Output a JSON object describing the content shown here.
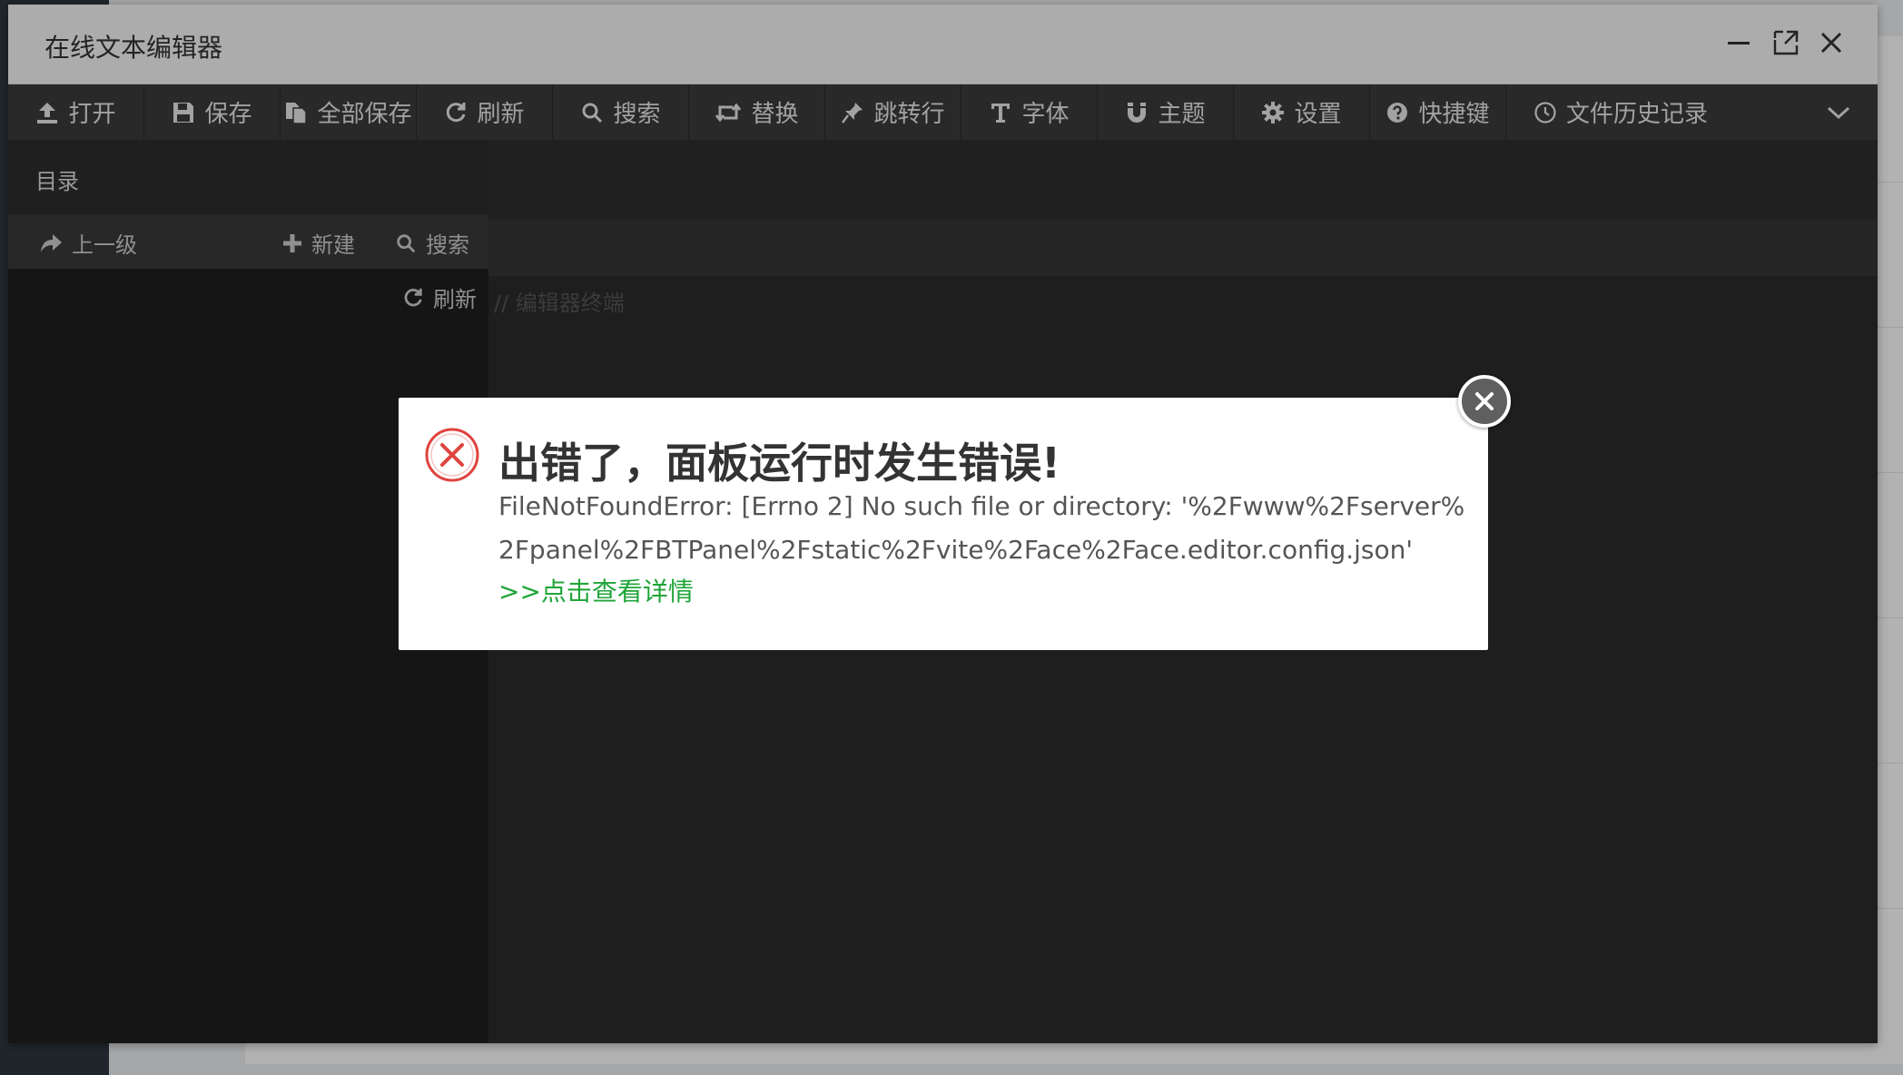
{
  "window": {
    "title": "在线文本编辑器"
  },
  "toolbar": {
    "items": [
      {
        "label": "打开",
        "icon": "upload-icon"
      },
      {
        "label": "保存",
        "icon": "save-icon"
      },
      {
        "label": "全部保存",
        "icon": "copy-icon"
      },
      {
        "label": "刷新",
        "icon": "refresh-icon"
      },
      {
        "label": "搜索",
        "icon": "search-icon"
      },
      {
        "label": "替换",
        "icon": "retweet-icon"
      },
      {
        "label": "跳转行",
        "icon": "pin-icon"
      },
      {
        "label": "字体",
        "icon": "text-icon"
      },
      {
        "label": "主题",
        "icon": "magnet-icon"
      },
      {
        "label": "设置",
        "icon": "gear-icon"
      },
      {
        "label": "快捷键",
        "icon": "question-icon"
      },
      {
        "label": "文件历史记录",
        "icon": "clock-icon"
      }
    ]
  },
  "sidebar": {
    "title": "目录",
    "up_label": "上一级",
    "new_label": "新建",
    "search_label": "搜索",
    "refresh_label": "刷新"
  },
  "editor": {
    "comment": "// 编辑器终端"
  },
  "dialog": {
    "title": "出错了，面板运行时发生错误!",
    "message": "FileNotFoundError: [Errno 2] No such file or directory: '%2Fwww%2Fserver%2Fpanel%2FBTPanel%2Fstatic%2Fvite%2Face%2Face.editor.config.json'",
    "link": ">>点击查看详情"
  },
  "colors": {
    "error": "#e0443e",
    "link": "#20a53a",
    "toolbar_bg": "#3c3c3c"
  }
}
